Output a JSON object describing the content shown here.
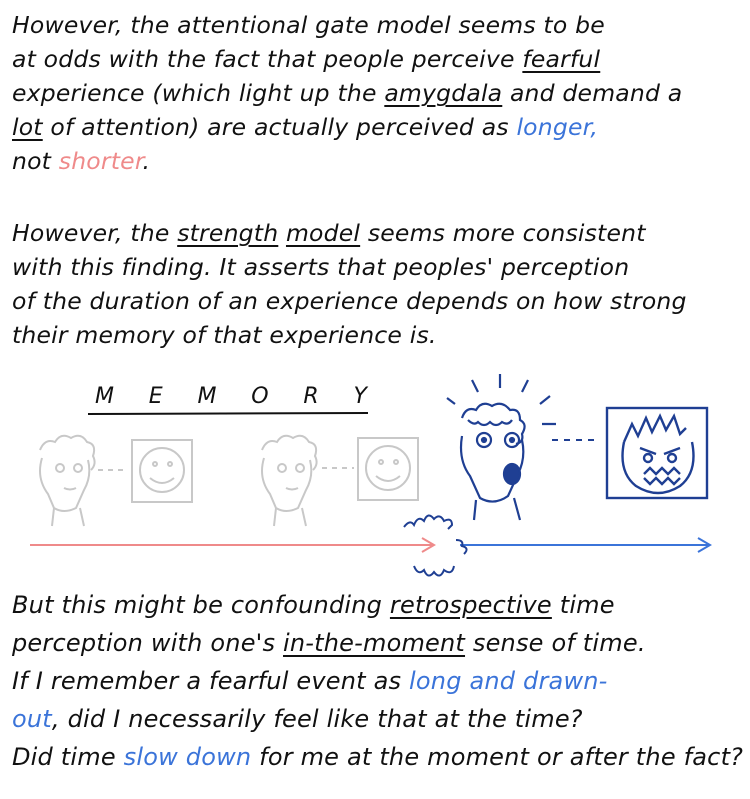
{
  "paragraph1": {
    "line1": "However, the attentional gate model seems to be",
    "line2_a": "at odds with the fact that people perceive ",
    "line2_b": "fearful",
    "line3_a": "experience (which light up the ",
    "line3_b": "amygdala",
    "line3_c": " and demand a",
    "line4_a": "lot",
    "line4_b": " of attention) are actually perceived as ",
    "line4_c": "longer,",
    "line5_a": "not ",
    "line5_b": "shorter",
    "line5_c": "."
  },
  "paragraph2": {
    "line1_a": "However, the ",
    "line1_b": "strength",
    "line1_c": " ",
    "line1_d": "model",
    "line1_e": " seems more consistent",
    "line2": "with this finding. It asserts that peoples' perception",
    "line3": "of the duration of an experience depends on how strong",
    "line4": "their memory of that experience is."
  },
  "memory_label": [
    "M",
    "E",
    "M",
    "O",
    "R",
    "Y"
  ],
  "paragraph3": {
    "line1_a": "But this might be confounding ",
    "line1_b": "retrospective",
    "line1_c": " time",
    "line2_a": "perception with one's ",
    "line2_b": "in-the-moment",
    "line2_c": " sense of time.",
    "line3_a": "If I remember a fearful event as ",
    "line3_b": "long and drawn-",
    "line4_a": "out",
    "line4_b": ", did I necessarily feel like that at the time?",
    "line5_a": "Did time ",
    "line5_b": "slow down",
    "line5_c": " for me at the moment or after the fact?"
  },
  "colors": {
    "ink": "#111111",
    "blue": "#3b74d9",
    "pink": "#ef8a8a",
    "faded": "#c8c8c8",
    "dark_blue": "#1f3f93"
  }
}
